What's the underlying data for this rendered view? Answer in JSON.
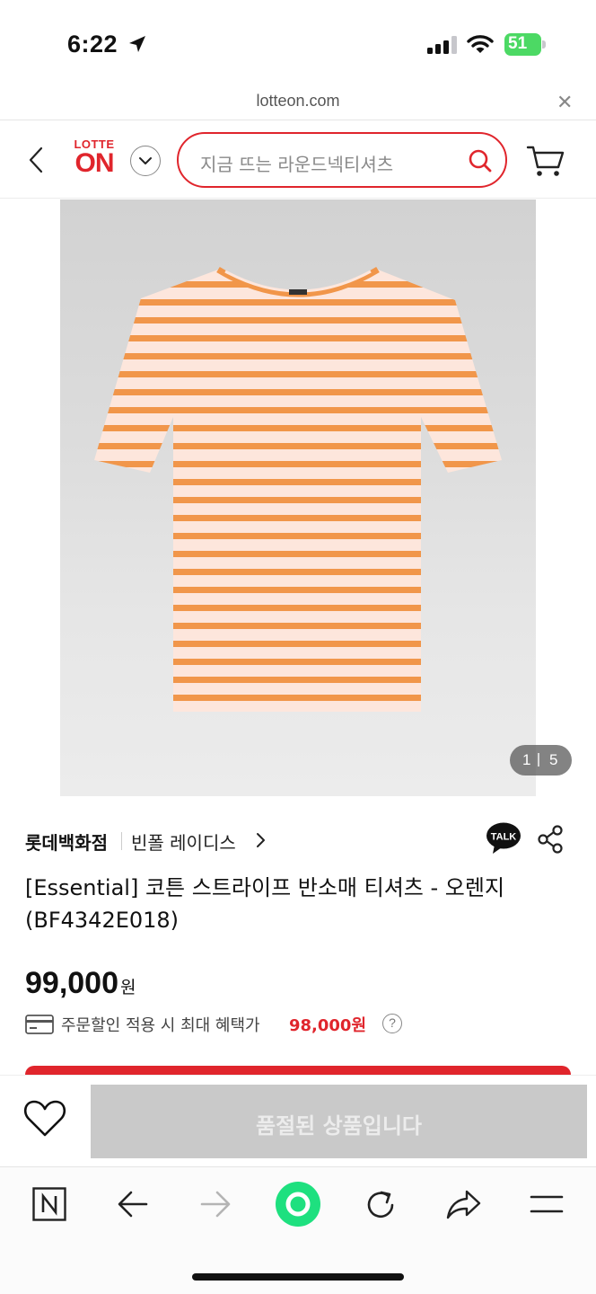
{
  "status_bar": {
    "time": "6:22",
    "battery": "51",
    "icons": [
      "location-arrow-icon",
      "signal-icon",
      "wifi-icon",
      "battery-icon"
    ]
  },
  "url_bar": {
    "url": "lotteon.com",
    "close_icon": "close-icon"
  },
  "header": {
    "logo_top": "LOTTE",
    "logo_main": "ON",
    "search_placeholder": "지금 뜨는 라운드넥티셔츠",
    "icons": [
      "back-icon",
      "chevron-down-icon",
      "search-icon",
      "cart-icon"
    ]
  },
  "gallery": {
    "current": "1",
    "total": "5",
    "stripe_color": "#f1964a",
    "base_color": "#fde6dc"
  },
  "product": {
    "store": "롯데백화점",
    "brand": "빈폴 레이디스",
    "talk_label": "TALK",
    "title": "[Essential] 코튼 스트라이프 반소매 티셔츠 - 오렌지 (BF4342E018)",
    "price": "99,000",
    "price_unit": "원",
    "benefit_text": "주문할인 적용 시 최대 혜택가",
    "benefit_price": "98,000원",
    "help": "?"
  },
  "purchase_bar": {
    "soldout_label": "품절된 상품입니다"
  },
  "browser_toolbar": {
    "items": [
      "naver-icon",
      "back-arrow-icon",
      "forward-arrow-icon",
      "home-circle-icon",
      "refresh-icon",
      "share-arrow-icon",
      "menu-icon"
    ]
  },
  "colors": {
    "brand_red": "#e0252c",
    "green": "#1ee07f"
  }
}
